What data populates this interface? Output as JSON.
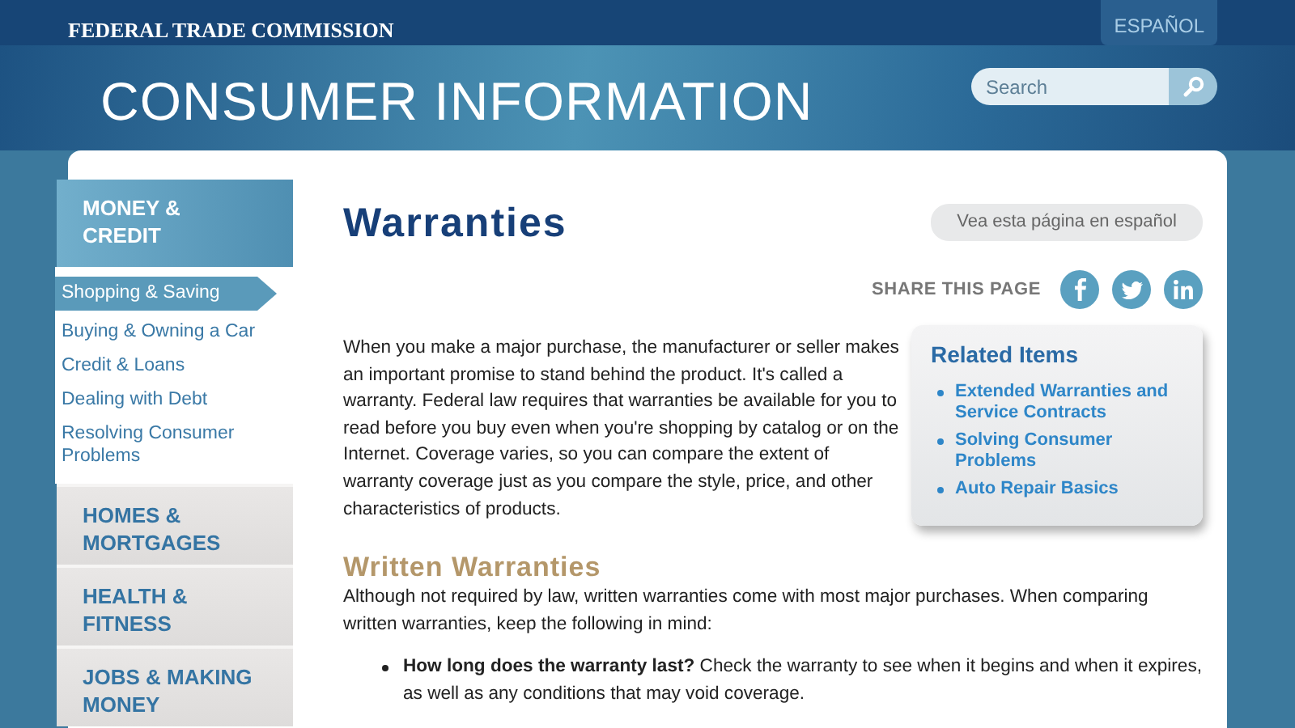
{
  "top_bar": {
    "agency": "FEDERAL TRADE COMMISSION",
    "language_link": "ESPAÑOL"
  },
  "header": {
    "title": "CONSUMER INFORMATION",
    "search": {
      "placeholder": "Search"
    }
  },
  "sidebar": {
    "sections": [
      {
        "label": "MONEY & CREDIT",
        "selected": true,
        "children": [
          {
            "label": "Shopping & Saving",
            "selected": true
          },
          {
            "label": "Buying & Owning a Car",
            "selected": false
          },
          {
            "label": "Credit & Loans",
            "selected": false
          },
          {
            "label": "Dealing with Debt",
            "selected": false
          },
          {
            "label": "Resolving Consumer Problems",
            "selected": false
          }
        ]
      },
      {
        "label": "HOMES & MORTGAGES",
        "selected": false
      },
      {
        "label": "HEALTH & FITNESS",
        "selected": false
      },
      {
        "label": "JOBS & MAKING MONEY",
        "selected": false
      }
    ]
  },
  "article": {
    "title": "Warranties",
    "spanish_link": "Vea esta página en español",
    "share_label": "SHARE THIS PAGE",
    "share_buttons": [
      {
        "kind": "facebook"
      },
      {
        "kind": "twitter"
      },
      {
        "kind": "linkedin"
      }
    ],
    "intro": "When you make a major purchase, the manufacturer or seller makes an important promise to stand behind the product. It's called a warranty. Federal law requires that warranties be available for you to read before you buy even when you're shopping by catalog or on the Internet. Coverage varies, so you can compare the extent of warranty coverage just as you compare the style, price, and other characteristics of products.",
    "related": {
      "title": "Related Items",
      "links": [
        "Extended Warranties and Service Contracts",
        "Solving Consumer Problems",
        "Auto Repair Basics"
      ]
    },
    "section_heading": "Written Warranties",
    "section_text": "Although not required by law, written warranties come with most major purchases. When comparing written warranties, keep the following in mind:",
    "bullets": [
      "**How long does the warranty last?** Check the warranty to see when it begins and when it expires, as well as any conditions that may void coverage."
    ]
  }
}
